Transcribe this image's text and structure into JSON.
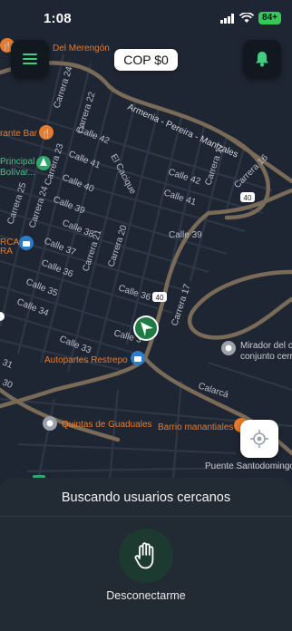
{
  "status_bar": {
    "time": "1:08",
    "battery": "84+"
  },
  "header": {
    "menu_icon": "hamburger-menu-icon",
    "balance": "COP $0",
    "notification_icon": "bell-icon"
  },
  "map": {
    "highway_label": "Armenia - Pereira - Manizales",
    "route_badges": [
      "40",
      "40"
    ],
    "streets": {
      "calle_42_a": "Calle 42",
      "calle_41_a": "Calle 41",
      "calle_40": "Calle 40",
      "calle_39_a": "Calle 39",
      "calle_38": "Calle 38",
      "calle_37": "Calle 37",
      "calle_36_a": "Calle 36",
      "calle_35": "Calle 35",
      "calle_34": "Calle 34",
      "calle_33": "Calle 33",
      "calle_42_b": "Calle 42",
      "calle_41_b": "Calle 41",
      "calle_39_b": "Calle 39",
      "calle_36_b": "Calle 36",
      "calle_3x": "Calle 3",
      "carrera_24_a": "Carrera 24",
      "carrera_24_b": "Carrera 24",
      "carrera_25": "Carrera 25",
      "carrera_23": "Carrera 23",
      "carrera_22": "Carrera 22",
      "carrera_21": "Carrera 21",
      "carrera_20": "Carrera 20",
      "carrera_17_a": "Carrera 17",
      "carrera_17_b": "Carrera 17",
      "carrera_16": "Carrera 16",
      "el_cacique": "El Cacique",
      "calarca": "Calarcá",
      "edge_31": "31",
      "edge_30": "30",
      "edge_ra": "RA"
    },
    "places": {
      "merengon": "Del Merengón",
      "rante_bar": "rante Bar",
      "principal": "Principal",
      "bolivar": "Bolívar...",
      "rca": "RCA",
      "autopartes": "Autopartes Restrepo",
      "mirador_1": "Mirador del c",
      "mirador_2": "conjunto cerr",
      "quintas": "Quintas de Guaduales",
      "barrio": "Barrio manantiales",
      "puente": "Puente Santodomingo"
    }
  },
  "bottom_sheet": {
    "status_text": "Buscando usuarios cercanos",
    "disconnect_icon": "raised-hand-icon",
    "disconnect_label": "Desconectarme"
  },
  "colors": {
    "map_background": "#1f2633",
    "major_road": "#7a6b58",
    "accent_green": "#1f7a44",
    "poi_orange": "#e87b2b",
    "poi_blue": "#2d7cc9",
    "sheet_background": "#222a34"
  }
}
